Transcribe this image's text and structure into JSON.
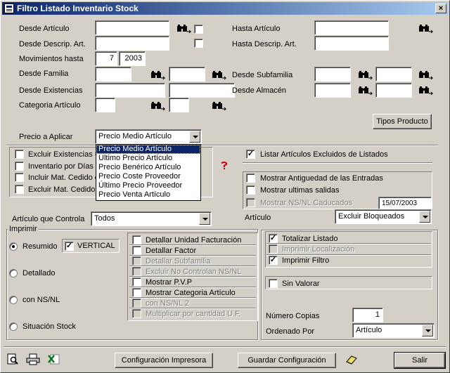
{
  "window": {
    "title": "Filtro Listado Inventario Stock",
    "close": "×"
  },
  "filters": {
    "desde_articulo": "Desde Artículo",
    "hasta_articulo": "Hasta Artículo",
    "desde_descrip": "Desde Descrip. Art.",
    "hasta_descrip": "Hasta Descrip. Art.",
    "movimientos_hasta": "Movimientos hasta",
    "mov_month": "7",
    "mov_year": "2003",
    "desde_familia": "Desde Familia",
    "desde_subfamilia": "Desde Subfamilia",
    "desde_existencias": "Desde Existencias",
    "desde_almacen": "Desde Almacén",
    "categoria_articulo": "Categoria Artículo"
  },
  "tipos_producto_button": "Tipos Producto",
  "precio": {
    "label": "Precio a Aplicar",
    "selected": "Precio Medio Artículo",
    "options": [
      "Precio Medio Artículo",
      "Último Precio Artículo",
      "Precio Benérico Artículo",
      "Precio Coste Proveedor",
      "Último Precio Proveedor",
      "Precio Venta Artículo"
    ]
  },
  "left_checks": {
    "excluir_existencias": "Excluir Existencias =",
    "inventario_por_dias": "Inventario por Días",
    "incluir_mat_cedido": "Incluir Mat. Cedido e",
    "excluir_mat_cedido": "Excluir Mat. Cedido e"
  },
  "right_checks": {
    "listar_excluidos": "Listar Artículos Excluidos de Listados",
    "mostrar_antiguedad": "Mostrar Antiguedad de las Entradas",
    "mostrar_ultimas_salidas": "Mostrar ultimas salidas",
    "mostrar_nsnl_caducados": "Mostrar NS/NL Caducados",
    "caducados_date": "15/07/2003"
  },
  "articulo_controla": {
    "label": "Artículo que Controla",
    "value": "Todos"
  },
  "articulo": {
    "label": "Artículo",
    "value": "Excluir Bloqueados"
  },
  "imprimir": {
    "title": "Imprimir",
    "resumido": "Resumido",
    "vertical": "VERTICAL",
    "detallado": "Detallado",
    "con_nsnl": "con NS/NL",
    "situacion_stock": "Situación Stock"
  },
  "detail_checks": {
    "detallar_unidad_facturacion": "Detallar Unidad Facturación",
    "detallar_factor": "Detallar Factor",
    "detallar_subfamilia": "Detallar Subfamilia",
    "excluir_no_controlan": "Excluir No Controlan NS/NL",
    "mostrar_pvp": "Mostrar P.V.P",
    "mostrar_categoria": "Mostrar Categoria Artículo",
    "con_nsnl_2": "con NS/NL 2",
    "multiplicar": "Multiplicar por cantidad U.F."
  },
  "totals": {
    "totalizar_listado": "Totalizar Listado",
    "imprimir_localizacion": "Imprimir Localización",
    "imprimir_filtro": "Imprimir Filtro",
    "sin_valorar": "Sin Valorar"
  },
  "copias": {
    "label": "Número Copias",
    "value": "1"
  },
  "ordenado": {
    "label": "Ordenado Por",
    "value": "Artículo"
  },
  "footer": {
    "configuracion_impresora": "Configuración Impresora",
    "guardar_configuracion": "Guardar Configuración",
    "salir": "Salir"
  },
  "icons": {
    "binoculars": "binoculars-icon",
    "preview": "print-preview-icon",
    "printer": "printer-icon",
    "excel": "excel-icon",
    "eraser": "eraser-icon"
  }
}
